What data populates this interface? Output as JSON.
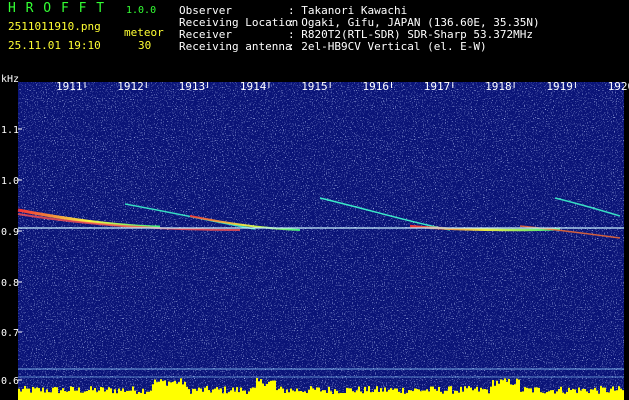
{
  "header": {
    "app_title": "H R O F F T",
    "version": "1.0.0",
    "filename": "2511011910.png",
    "datetime": "25.11.01 19:10",
    "meteor_label": "meteor",
    "meteor_count": "30"
  },
  "info": {
    "observer": {
      "label": "Observer",
      "value": ": Takanori Kawachi"
    },
    "location": {
      "label": "Receiving Location",
      "value": ": Ogaki, Gifu, JAPAN (136.60E, 35.35N)"
    },
    "receiver": {
      "label": "Receiver",
      "value": ": R820T2(RTL-SDR) SDR-Sharp 53.372MHz"
    },
    "antenna": {
      "label": "Receiving antenna",
      "value": ": 2el-HB9CV Vertical (el. E-W)"
    }
  },
  "axes": {
    "y_unit": "kHz",
    "y_ticks": [
      "1.1",
      "1.0",
      "0.9",
      "0.8",
      "0.7",
      "0.6"
    ],
    "time_ticks": [
      "1911",
      "1912",
      "1913",
      "1914",
      "1915",
      "1916",
      "1917",
      "1918",
      "1919",
      "1920"
    ]
  },
  "colors": {
    "background": "#000000",
    "spectrogram_bg": "#0a1478",
    "header_green": "#33ff33",
    "header_yellow": "#ffff33",
    "signal_line": "#c8f0ff",
    "level_bar": "#ffff00"
  }
}
